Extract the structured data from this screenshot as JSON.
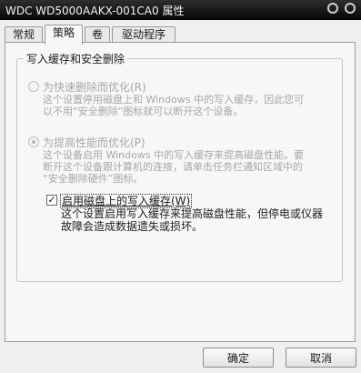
{
  "window": {
    "title": "WDC WD5000AAKX-001CA0 属性"
  },
  "tabs": [
    {
      "label": "常规",
      "active": false
    },
    {
      "label": "策略",
      "active": true
    },
    {
      "label": "卷",
      "active": false
    },
    {
      "label": "驱动程序",
      "active": false
    }
  ],
  "group": {
    "title": "写入缓存和安全删除"
  },
  "quick_removal": {
    "label": "为快速删除而优化(R)",
    "desc_line1": "这个设置停用磁盘上和 Windows 中的写入缓存，因此您可",
    "desc_line2": "以不用“安全删除”图标就可以断开这个设备。",
    "selected": false,
    "enabled": false
  },
  "performance": {
    "label": "为提高性能而优化(P)",
    "desc_line1": "这个设备启用 Windows 中的写入缓存来提高磁盘性能。要",
    "desc_line2": "断开这个设备跟计算机的连接，请单击任务栏通知区域中的",
    "desc_line3": "“安全删除硬件”图标。",
    "selected": true,
    "enabled": false
  },
  "write_cache": {
    "label": "启用磁盘上的写入缓存(W)",
    "checked": true,
    "check_mark": "✓",
    "desc_line1": "这个设置启用写入缓存来提高磁盘性能，但停电或仪器",
    "desc_line2": "故障会造成数据遗失或损坏。"
  },
  "buttons": {
    "ok": "确定",
    "cancel": "取消"
  }
}
